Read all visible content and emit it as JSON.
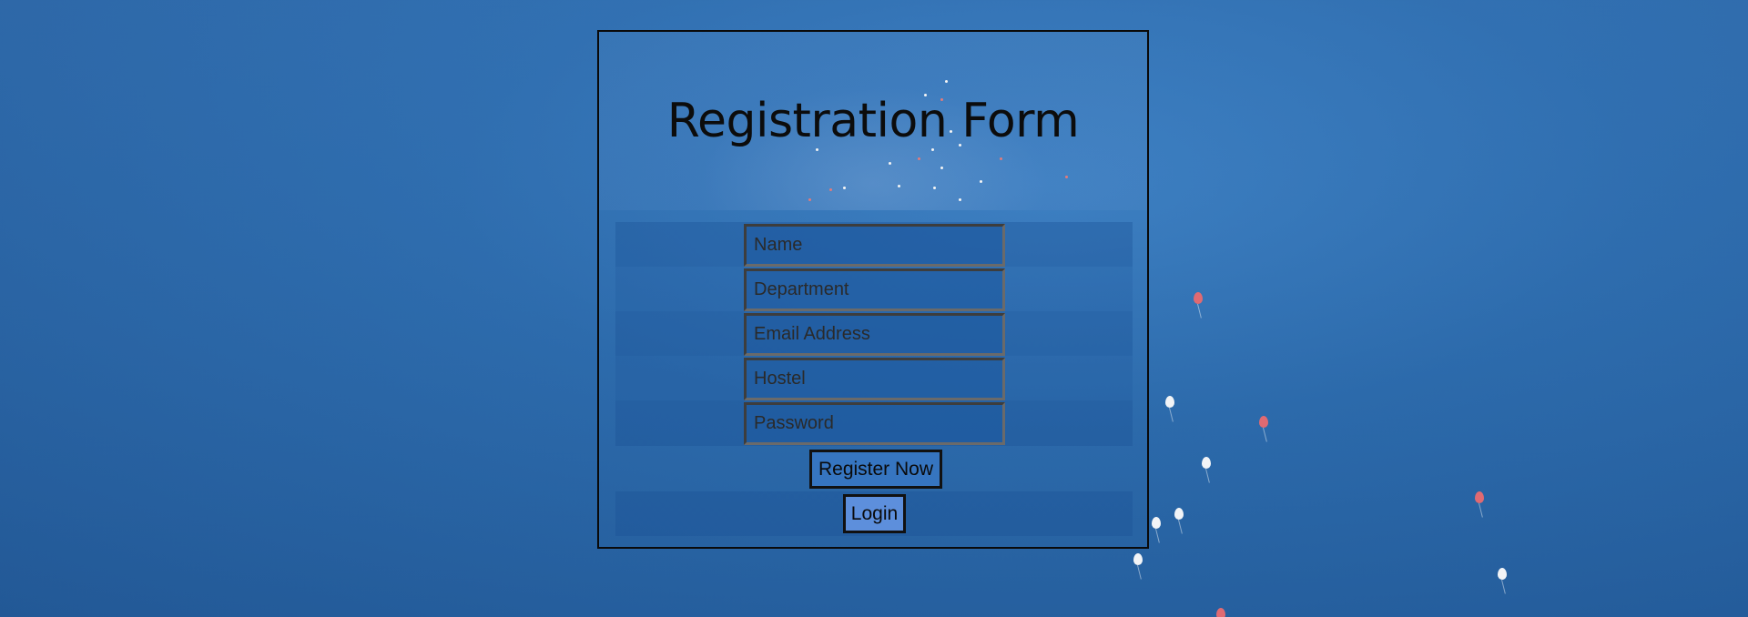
{
  "form": {
    "title": "Registration Form",
    "fields": {
      "name": {
        "placeholder": "Name",
        "value": ""
      },
      "department": {
        "placeholder": "Department",
        "value": ""
      },
      "email": {
        "placeholder": "Email Address",
        "value": ""
      },
      "hostel": {
        "placeholder": "Hostel",
        "value": ""
      },
      "password": {
        "placeholder": "Password",
        "value": ""
      }
    },
    "register_label": "Register Now",
    "login_label": "Login"
  },
  "colors": {
    "background": "#2b6cb0",
    "border": "#0a0a0a",
    "text": "#0c0c0c"
  }
}
